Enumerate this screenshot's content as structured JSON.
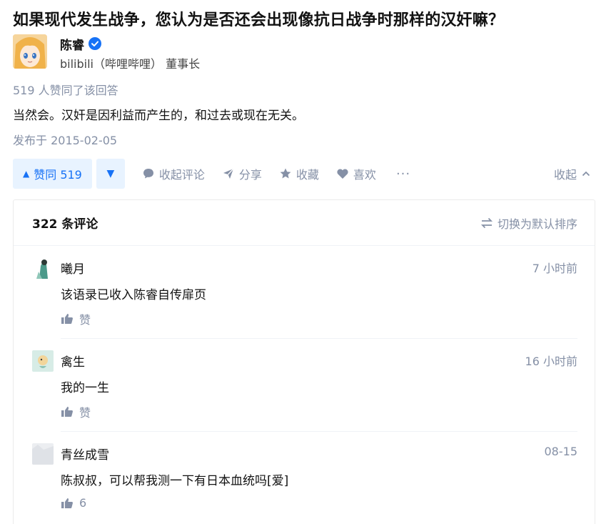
{
  "question": {
    "title": "如果现代发生战争，您认为是否还会出现像抗日战争时那样的汉奸嘛？"
  },
  "author": {
    "name": "陈睿",
    "verified_icon": "verified-badge-icon",
    "bio": "bilibili（哔哩哔哩） 董事长"
  },
  "answer": {
    "vote_summary": "519 人赞同了该回答",
    "content": "当然会。汉奸是因利益而产生的，和过去或现在无关。",
    "published": "发布于 2015-02-05"
  },
  "actions": {
    "vote_up_label": "赞同 519",
    "collapse_comments": "收起评论",
    "share": "分享",
    "favorite": "收藏",
    "like": "喜欢",
    "more": "···",
    "collapse": "收起"
  },
  "comments": {
    "count_label": "322 条评论",
    "sort_label": "切换为默认排序",
    "items": [
      {
        "name": "曦月",
        "time": "7 小时前",
        "text": "该语录已收入陈睿自传扉页",
        "like": "赞"
      },
      {
        "name": "禽生",
        "time": "16 小时前",
        "text": "我的一生",
        "like": "赞"
      },
      {
        "name": "青丝成雪",
        "time": "08-15",
        "text": "陈叔叔，可以帮我测一下有日本血统吗[爱]",
        "like": "6"
      }
    ]
  },
  "colors": {
    "accent": "#1772f6",
    "accent_bg": "#e8f3ff",
    "meta_gray": "#8590a6",
    "text": "#121212"
  }
}
